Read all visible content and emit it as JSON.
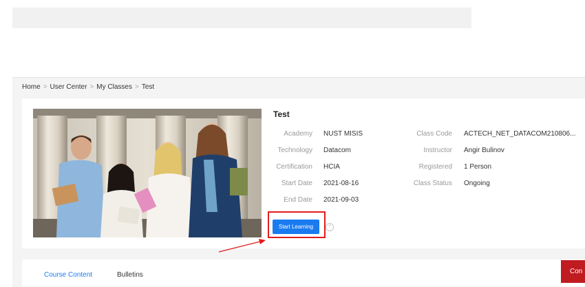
{
  "breadcrumb": {
    "home": "Home",
    "user_center": "User Center",
    "my_classes": "My Classes",
    "current": "Test",
    "separator": ">"
  },
  "class": {
    "title": "Test",
    "fields": {
      "academy": {
        "label": "Academy",
        "value": "NUST MISIS"
      },
      "technology": {
        "label": "Technology",
        "value": "Datacom"
      },
      "certification": {
        "label": "Certification",
        "value": "HCIA"
      },
      "start_date": {
        "label": "Start Date",
        "value": "2021-08-16"
      },
      "end_date": {
        "label": "End Date",
        "value": "2021-09-03"
      },
      "class_code": {
        "label": "Class Code",
        "value": "ACTECH_NET_DATACOM210806..."
      },
      "instructor": {
        "label": "Instructor",
        "value": "Angir Bulinov"
      },
      "registered": {
        "label": "Registered",
        "value": "1 Person"
      },
      "class_status": {
        "label": "Class Status",
        "value": "Ongoing"
      }
    },
    "start_button": "Start Learning",
    "help_symbol": "?"
  },
  "tabs": [
    {
      "label": "Course Content",
      "active": true
    },
    {
      "label": "Bulletins",
      "active": false
    }
  ],
  "consult_button": "Con",
  "colors": {
    "accent": "#1a7bf0",
    "highlight": "#e01b1b",
    "consult": "#c01b20"
  }
}
